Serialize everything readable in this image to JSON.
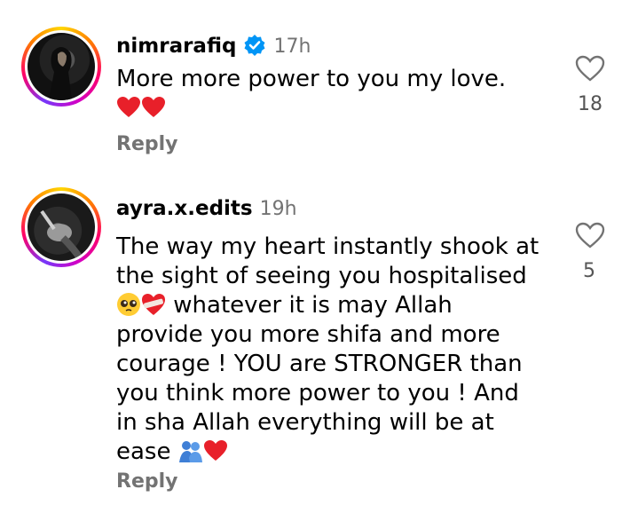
{
  "comments": [
    {
      "username": "nimrarafiq",
      "verified": true,
      "time": "17h",
      "line1": "More more power to you my love.",
      "emojis": [
        "red-heart",
        "red-heart"
      ],
      "reply_label": "Reply",
      "like_count": "18"
    },
    {
      "username": "ayra.x.edits",
      "verified": false,
      "time": "19h",
      "text_a": "The way my heart instantly shook at the sight of seeing you hospitalised ",
      "text_b": " whatever it is may Allah provide you more shifa and more courage ! YOU are STRONGER than you think more power to you ! And in sha Allah everything will be at ease ",
      "emojis_mid": [
        "pleading-face",
        "mending-heart"
      ],
      "emojis_end": [
        "people-hugging",
        "red-heart"
      ],
      "reply_label": "Reply",
      "like_count": "5"
    }
  ],
  "colors": {
    "secondary_text": "#737373",
    "verified_blue": "#0095f6",
    "heart_red": "#e8202a"
  }
}
